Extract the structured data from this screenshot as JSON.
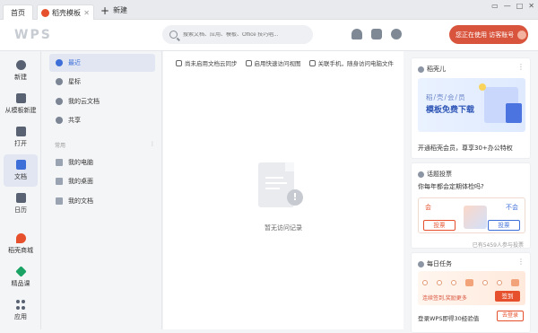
{
  "tabs": {
    "home": "首页",
    "template": "稻壳模板",
    "new_tab": "新建"
  },
  "window": {
    "minimize": "—",
    "maximize": "□",
    "close": "✕",
    "pin": "▭"
  },
  "header": {
    "logo": "WPS",
    "search_placeholder": "搜索文档、应用、模板、Office 技巧唱...",
    "user_button": "您正在使用 访客账号"
  },
  "sidebar": {
    "items": [
      {
        "label": "新建",
        "icon": "plus-circle-icon"
      },
      {
        "label": "从模板新建",
        "icon": "template-icon"
      },
      {
        "label": "打开",
        "icon": "folder-icon"
      },
      {
        "label": "文档",
        "icon": "document-icon"
      },
      {
        "label": "日历",
        "icon": "calendar-icon"
      },
      {
        "label": "稻壳商城",
        "icon": "docer-icon"
      },
      {
        "label": "精品课",
        "icon": "course-icon"
      },
      {
        "label": "应用",
        "icon": "apps-icon"
      }
    ]
  },
  "nav": {
    "items": [
      "最近",
      "星标",
      "我的云文档",
      "共享"
    ],
    "section": "常用",
    "more": "⋮",
    "folders": [
      "我的电脑",
      "我的桌面",
      "我的文档"
    ]
  },
  "main": {
    "toolbar": [
      "尚未启用文档云同步",
      "启用快速访问视图",
      "关联手机，随身访问电脑文件"
    ],
    "empty_text": "暂无访问记录"
  },
  "right": {
    "card1": {
      "title": "稻壳儿",
      "more": "⋮",
      "banner_small": "稻/壳/会/员",
      "banner_big": "模板免费下载",
      "text": "开通稻壳会员，尊享30+办公特权"
    },
    "card2": {
      "title": "话题投票",
      "question": "你每年都会定期体检吗?",
      "yes": "会",
      "no": "不会",
      "vote_btn": "投票",
      "count": "已有5459人参与投票"
    },
    "card3": {
      "title": "每日任务",
      "more": "⋮",
      "continuous": "连续签到,奖励更多",
      "sign_btn": "签到",
      "task": "登录WPS即得30经验值",
      "go_btn": "去登录"
    }
  },
  "colors": {
    "accent": "#3e6fd8",
    "brand": "#e6502c",
    "user_btn": "#d8543c"
  }
}
